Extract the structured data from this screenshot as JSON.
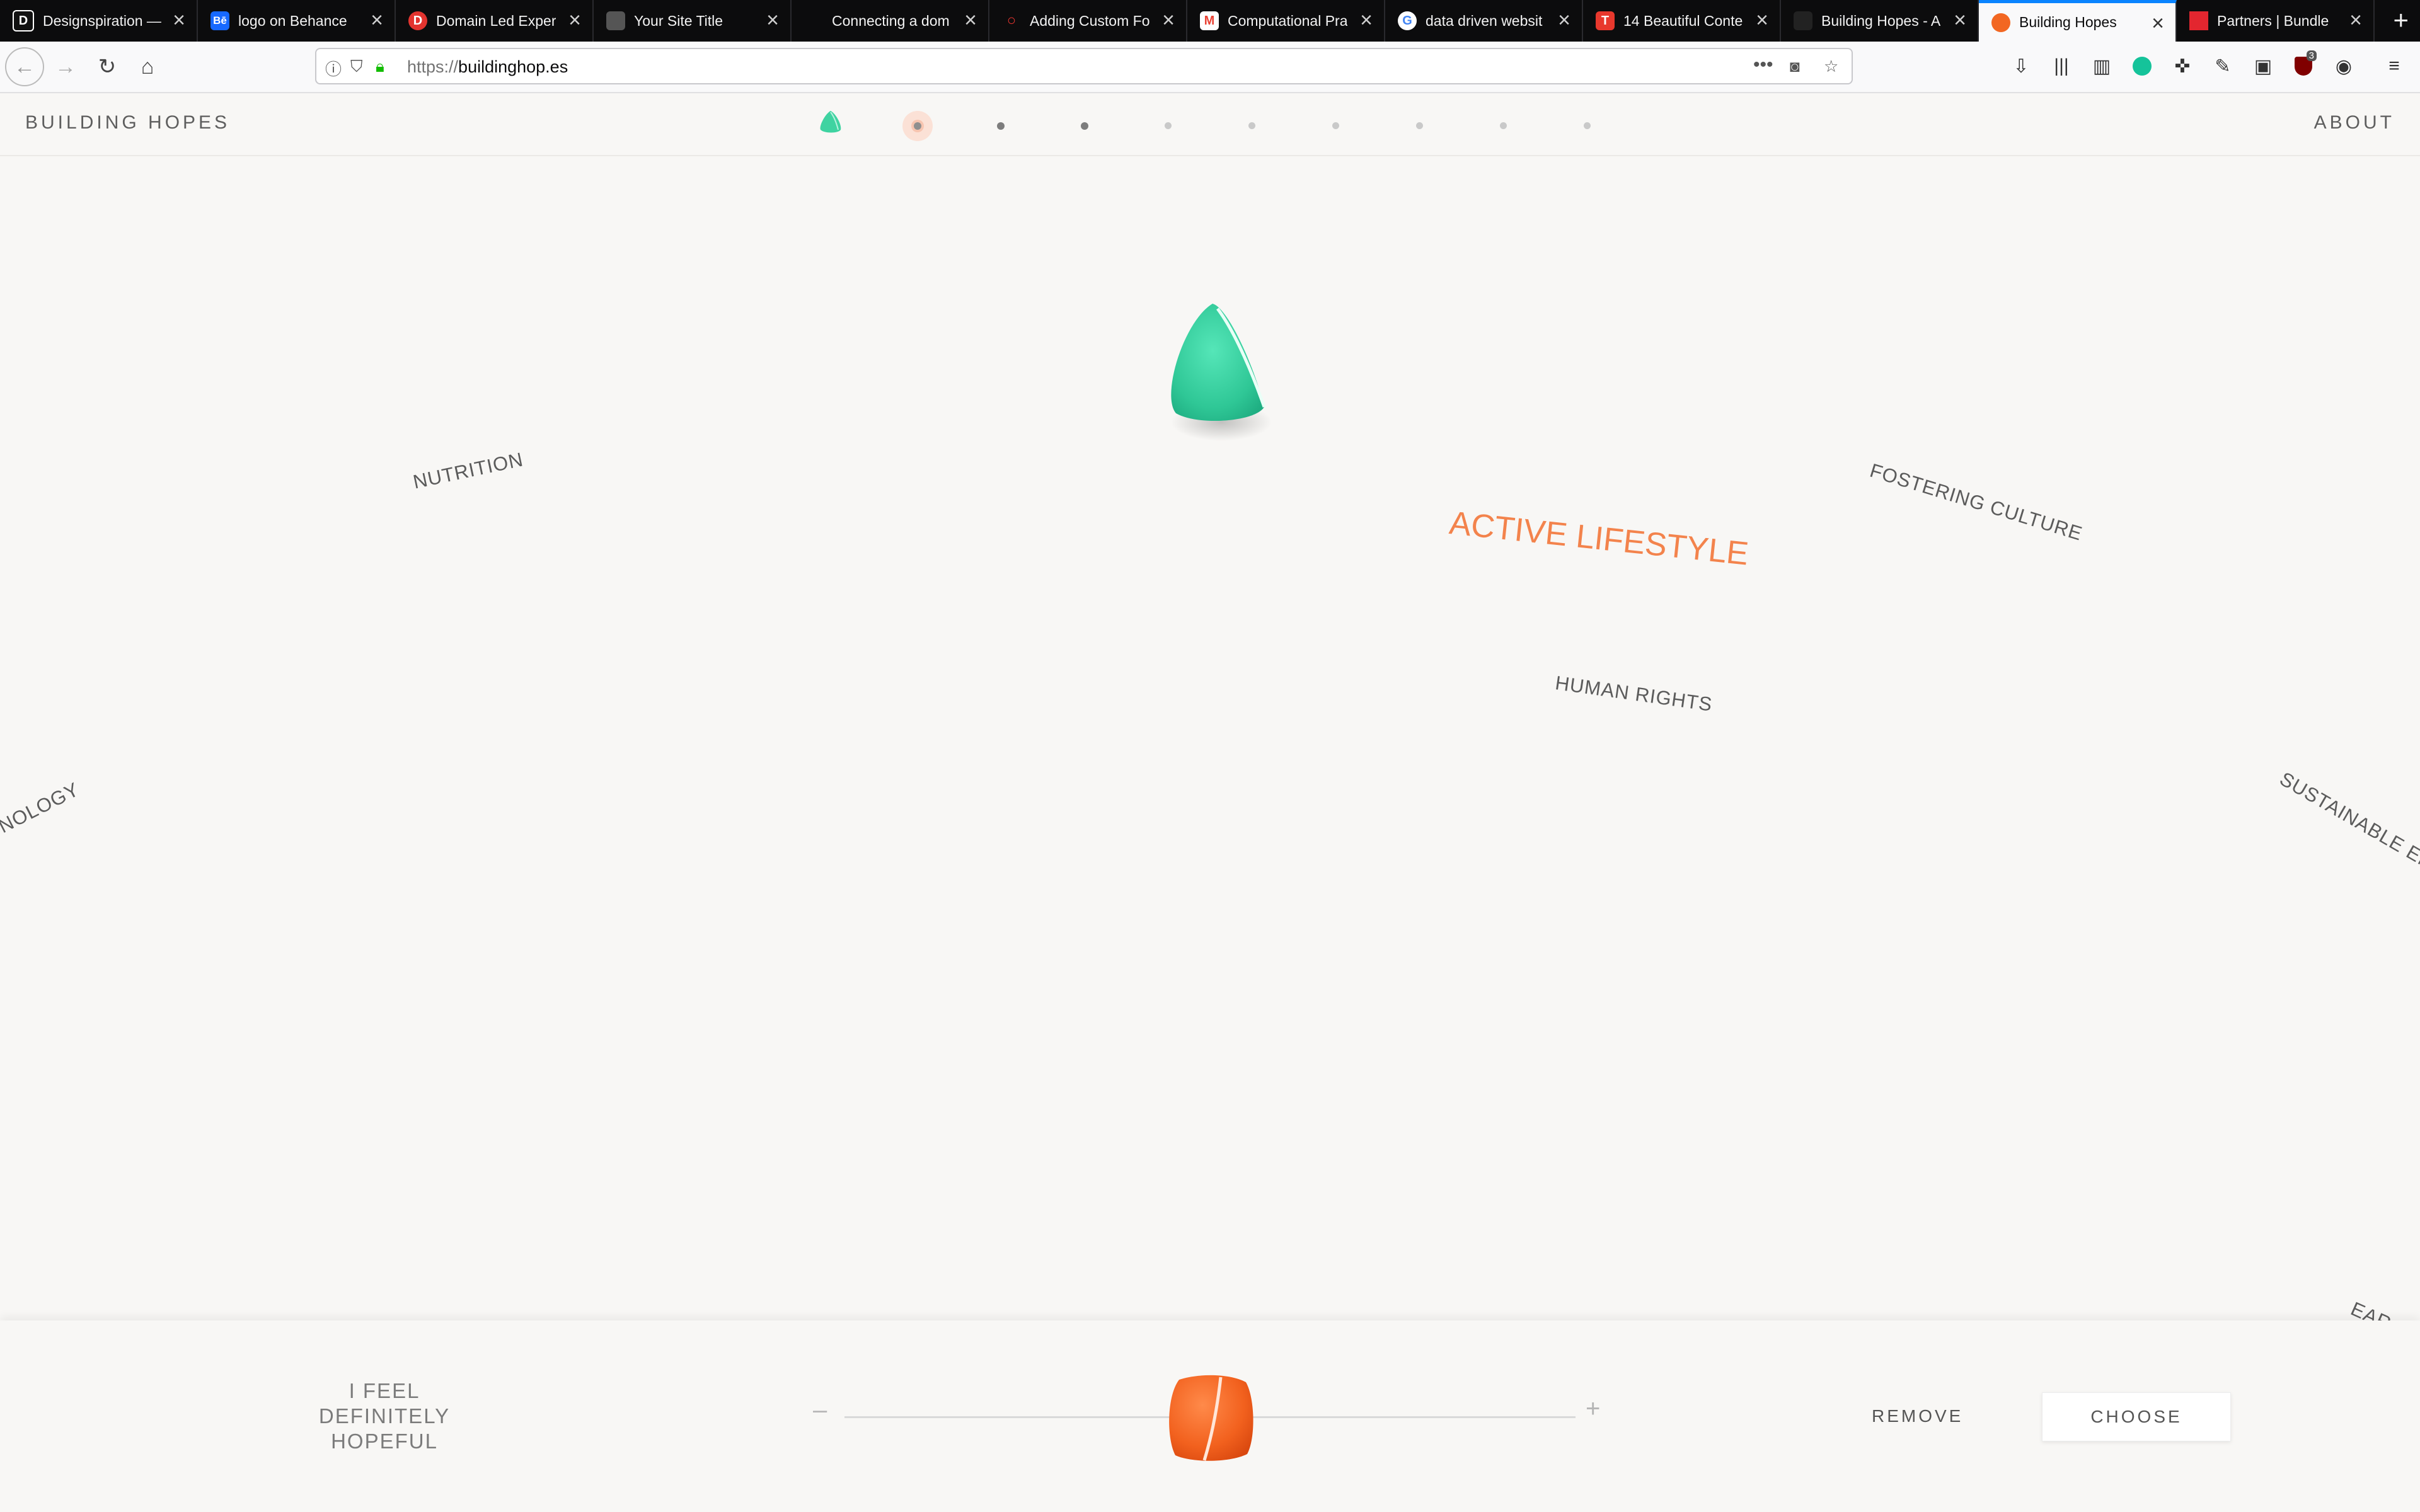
{
  "browser": {
    "tabs": [
      {
        "title": "Designspiration —",
        "favicon": "D",
        "favicon_color": "#111111",
        "active": false
      },
      {
        "title": "logo on Behance",
        "favicon": "Bē",
        "favicon_color": "#1769ff",
        "active": false
      },
      {
        "title": "Domain Led Exper",
        "favicon": "D",
        "favicon_color": "#e3342f",
        "active": false
      },
      {
        "title": "Your Site Title",
        "favicon": "",
        "favicon_color": "#666666",
        "active": false
      },
      {
        "title": "Connecting a dom",
        "favicon": "",
        "favicon_color": "#0c0c0d",
        "active": false
      },
      {
        "title": "Adding Custom Fo",
        "favicon": "○",
        "favicon_color": "#0c0c0d",
        "active": false
      },
      {
        "title": "Computational Pra",
        "favicon": "M",
        "favicon_color": "#ea4335",
        "active": false
      },
      {
        "title": "data driven websit",
        "favicon": "G",
        "favicon_color": "#4285f4",
        "active": false
      },
      {
        "title": "14 Beautiful Conte",
        "favicon": "T",
        "favicon_color": "#e8382d",
        "active": false
      },
      {
        "title": "Building Hopes - A",
        "favicon": "",
        "favicon_color": "#0c0c0d",
        "active": false
      },
      {
        "title": "Building Hopes",
        "favicon": "",
        "favicon_color": "#f26722",
        "active": true
      },
      {
        "title": "Partners | Bundle",
        "favicon": "",
        "favicon_color": "#e3262f",
        "active": false
      }
    ],
    "new_tab": "+",
    "url_scheme": "https://",
    "url_host": "buildinghop.es",
    "extension_badge": "3"
  },
  "site": {
    "brand": "BUILDING HOPES",
    "about": "ABOUT",
    "accent_color": "#f3834c",
    "gem_color": "#3fd3a1",
    "topics": {
      "nutrition": "NUTRITION",
      "active": "ACTIVE LIFESTYLE",
      "culture": "FOSTERING CULTURE",
      "rights": "HUMAN RIGHTS",
      "technology": "NOLOGY",
      "sustainable": "SUSTAINABLE EN",
      "earth": "EAR"
    }
  },
  "panel": {
    "feel_line1": "I FEEL",
    "feel_line2": "DEFINITELY",
    "feel_line3": "HOPEFUL",
    "minus": "–",
    "plus": "+",
    "remove": "REMOVE",
    "choose": "CHOOSE",
    "hope_level": 0.5
  }
}
